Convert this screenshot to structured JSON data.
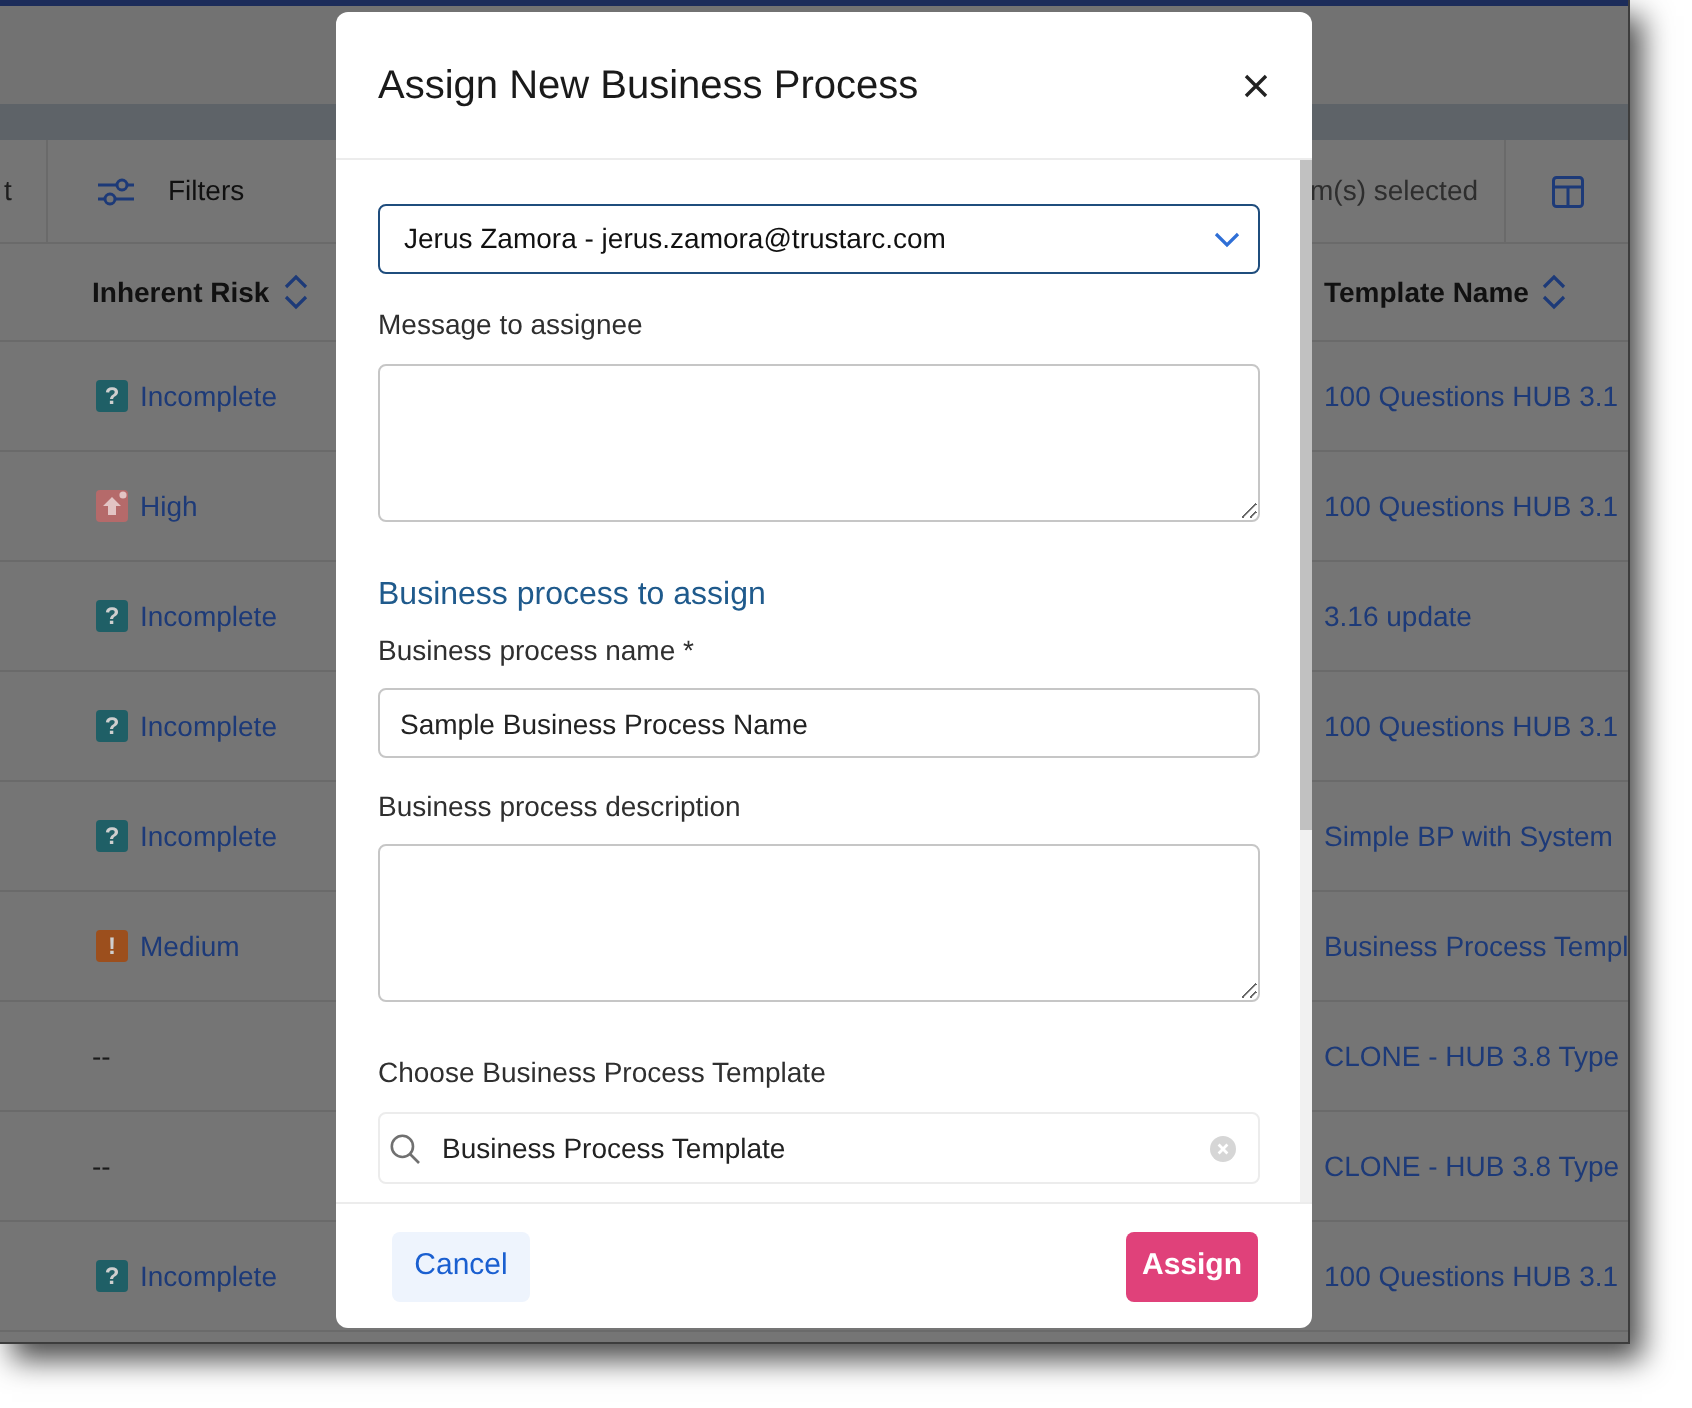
{
  "app": {
    "toolbar": {
      "cut_label": "t",
      "filters_button": "Filters",
      "selection_text": "m(s) selected"
    },
    "table": {
      "columns": [
        {
          "label": "Inherent Risk"
        },
        {
          "label": "Template Name"
        }
      ],
      "rows": [
        {
          "risk": {
            "kind": "incomplete",
            "symbol": "?",
            "label": "Incomplete"
          },
          "template": "100 Questions HUB 3.1"
        },
        {
          "risk": {
            "kind": "high",
            "label": "High"
          },
          "template": "100 Questions HUB 3.1"
        },
        {
          "risk": {
            "kind": "incomplete",
            "symbol": "?",
            "label": "Incomplete"
          },
          "template": "3.16 update"
        },
        {
          "risk": {
            "kind": "incomplete",
            "symbol": "?",
            "label": "Incomplete"
          },
          "template": "100 Questions HUB 3.1"
        },
        {
          "risk": {
            "kind": "incomplete",
            "symbol": "?",
            "label": "Incomplete"
          },
          "template": "Simple BP with System"
        },
        {
          "risk": {
            "kind": "medium",
            "symbol": "!",
            "label": "Medium"
          },
          "template": "Business Process Templ"
        },
        {
          "risk": {
            "kind": "none",
            "label": "--"
          },
          "template": "CLONE - HUB 3.8 Type"
        },
        {
          "risk": {
            "kind": "none",
            "label": "--"
          },
          "template": "CLONE - HUB 3.8 Type"
        },
        {
          "risk": {
            "kind": "incomplete",
            "symbol": "?",
            "label": "Incomplete"
          },
          "template": "100 Questions HUB 3.1"
        }
      ]
    }
  },
  "dialog": {
    "title": "Assign New Business Process",
    "assignee_select": {
      "value": "Jerus Zamora - jerus.zamora@trustarc.com"
    },
    "message_label": "Message to assignee",
    "section_heading": "Business process to assign",
    "name_label": "Business process name *",
    "name_field": {
      "value": "Sample Business Process Name"
    },
    "description_label": "Business process description",
    "template_label": "Choose Business Process Template",
    "template_search": {
      "value": "Business Process Template"
    },
    "buttons": [
      {
        "label": "Cancel",
        "kind": "secondary"
      },
      {
        "label": "Assign",
        "kind": "primary"
      }
    ]
  }
}
